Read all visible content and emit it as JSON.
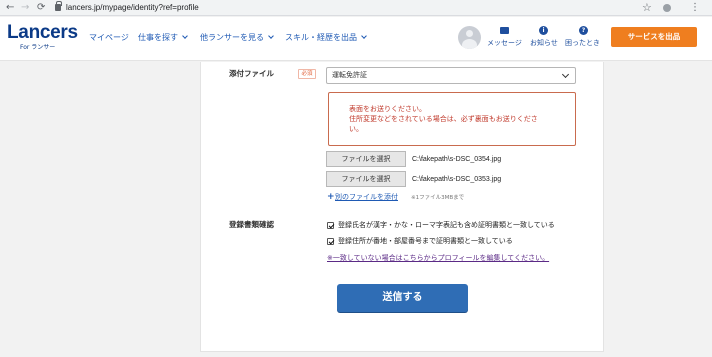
{
  "browser": {
    "url": "lancers.jp/mypage/identity?ref=profile"
  },
  "header": {
    "logo": "Lancers",
    "logo_sub": "For ランサー",
    "nav": [
      {
        "label": "マイページ",
        "has_dropdown": false
      },
      {
        "label": "仕事を探す",
        "has_dropdown": true
      },
      {
        "label": "他ランサーを見る",
        "has_dropdown": true
      },
      {
        "label": "スキル・経歴を出品",
        "has_dropdown": true
      }
    ],
    "icons": [
      {
        "label": "メッセージ",
        "icon": "mail-icon"
      },
      {
        "label": "お知らせ",
        "icon": "info-icon"
      },
      {
        "label": "困ったとき",
        "icon": "help-icon"
      }
    ],
    "service_button": "サービスを出品",
    "accent_color": "#ef7e1f",
    "brand_color": "#0b3a87"
  },
  "form": {
    "attachment_label": "添付ファイル",
    "required_badge": "必須",
    "document_select": "運転免許証",
    "alert_lines": [
      "表面をお送りください。",
      "住所変更などをされている場合は、必ず裏面もお送りくださ",
      "い。"
    ],
    "files": [
      {
        "button": "ファイルを選択",
        "name": "C:\\fakepath\\s-DSC_0354.jpg"
      },
      {
        "button": "ファイルを選択",
        "name": "C:\\fakepath\\s-DSC_0353.jpg"
      }
    ],
    "add_file_link": "別のファイルを添付",
    "file_size_note": "※1ファイル3MBまで",
    "confirm_label": "登録書類確認",
    "checks": [
      {
        "label": "登録氏名が漢字・かな・ローマ字表記も含め証明書類と一致している",
        "checked": true
      },
      {
        "label": "登録住所が番地・部屋番号まで証明書類と一致している",
        "checked": true
      }
    ],
    "edit_profile_link": "※一致していない場合はこちらからプロフィールを編集してください。",
    "submit_button": "送信する",
    "submit_color": "#2f6db5"
  }
}
